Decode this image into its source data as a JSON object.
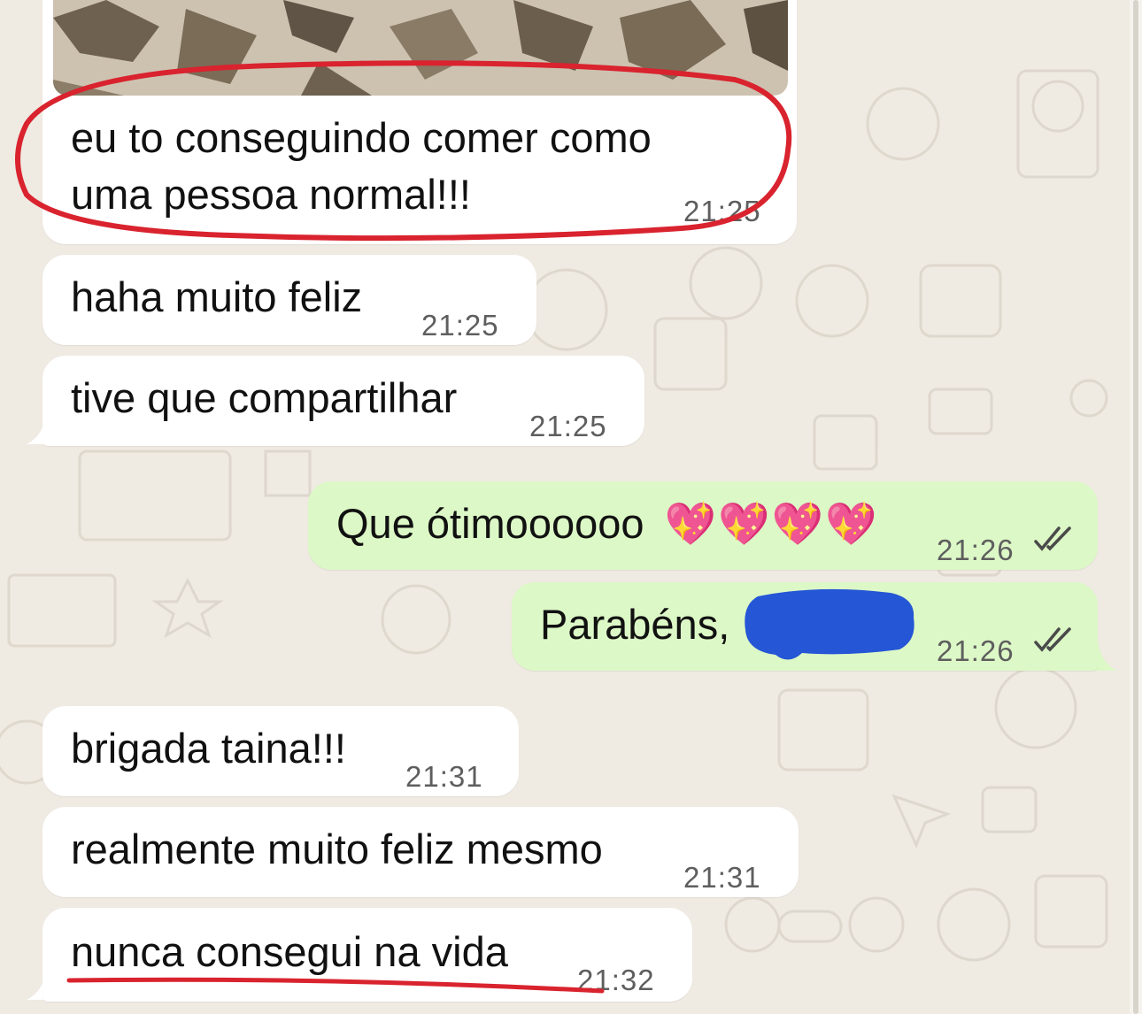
{
  "messages": [
    {
      "text_lines": [
        "eu to conseguindo comer como",
        "uma pessoa normal!!!"
      ],
      "time": "21:25",
      "direction": "incoming",
      "attachment": "photo"
    },
    {
      "text": "haha muito feliz",
      "time": "21:25",
      "direction": "incoming"
    },
    {
      "text": "tive que compartilhar",
      "time": "21:25",
      "direction": "incoming"
    },
    {
      "text": "Que ótimoooooo",
      "emoji": "💖💖💖💖",
      "time": "21:26",
      "direction": "outgoing",
      "status": "read-double-check-icon"
    },
    {
      "text": "Parabéns,",
      "time": "21:26",
      "direction": "outgoing",
      "status": "read-double-check-icon",
      "redacted": true
    },
    {
      "text": "brigada taina!!!",
      "time": "21:31",
      "direction": "incoming"
    },
    {
      "text": "realmente muito feliz mesmo",
      "time": "21:31",
      "direction": "incoming"
    },
    {
      "text": "nunca consegui na vida",
      "time": "21:32",
      "direction": "incoming"
    }
  ],
  "colors": {
    "chat_background": "#efeae2",
    "incoming_bubble": "#ffffff",
    "outgoing_bubble": "#dcf8c6",
    "annotation_red": "#d9232e",
    "redaction_blue": "#2456d6"
  }
}
